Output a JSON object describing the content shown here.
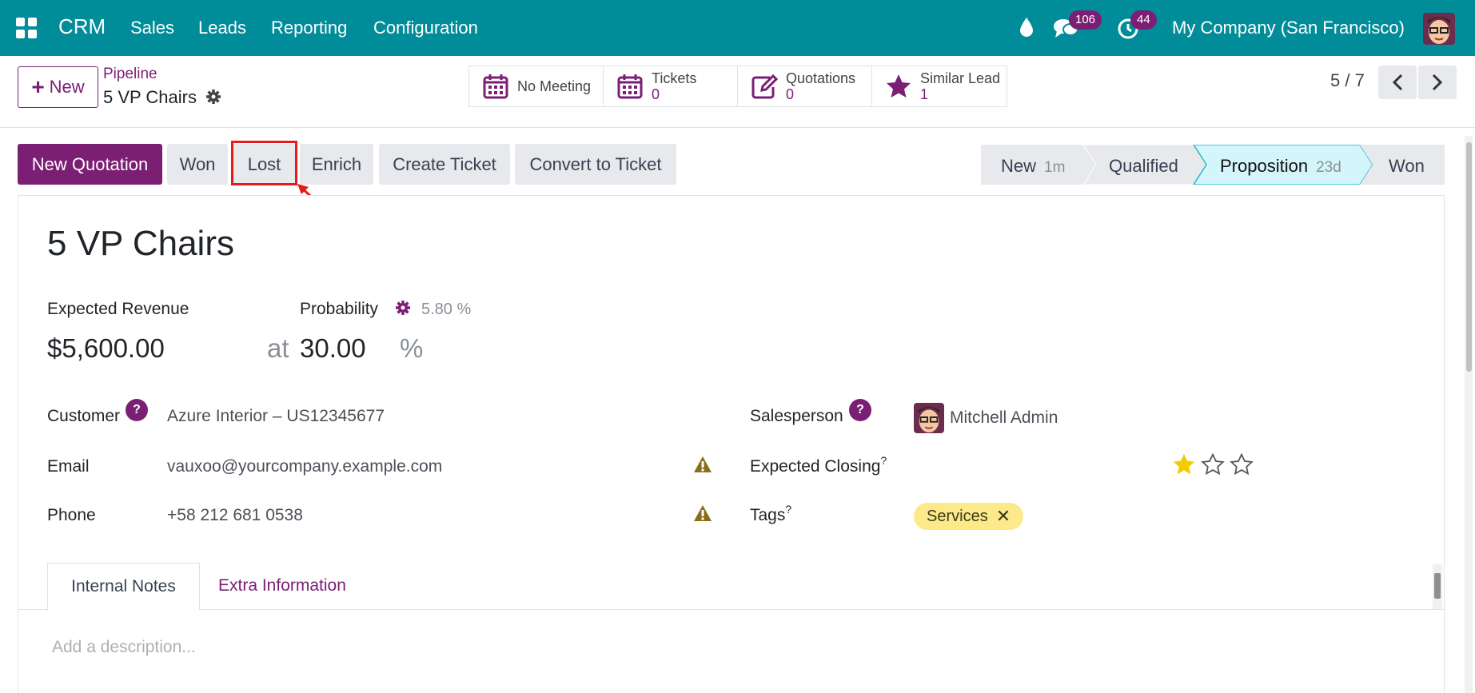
{
  "navbar": {
    "brand": "CRM",
    "menu": [
      "Sales",
      "Leads",
      "Reporting",
      "Configuration"
    ],
    "messages_count": "106",
    "activities_count": "44",
    "company": "My Company (San Francisco)"
  },
  "control_panel": {
    "new_label": "New",
    "breadcrumb_parent": "Pipeline",
    "breadcrumb_current": "5 VP Chairs",
    "smart_buttons": [
      {
        "label": "No Meeting",
        "value": ""
      },
      {
        "label": "Tickets",
        "value": "0"
      },
      {
        "label": "Quotations",
        "value": "0"
      },
      {
        "label": "Similar Lead",
        "value": "1"
      }
    ],
    "pager": "5 / 7"
  },
  "actions": {
    "new_quotation": "New Quotation",
    "won": "Won",
    "lost": "Lost",
    "enrich": "Enrich",
    "create_ticket": "Create Ticket",
    "convert_to_ticket": "Convert to Ticket"
  },
  "stages": [
    {
      "name": "New",
      "time": "1m",
      "active": false
    },
    {
      "name": "Qualified",
      "time": "",
      "active": false
    },
    {
      "name": "Proposition",
      "time": "23d",
      "active": true
    },
    {
      "name": "Won",
      "time": "",
      "active": false
    }
  ],
  "form": {
    "title": "5 VP Chairs",
    "expected_revenue_label": "Expected Revenue",
    "expected_revenue": "$5,600.00",
    "at": "at",
    "probability_label": "Probability",
    "probability_auto": "5.80 %",
    "probability": "30.00",
    "percent": "%",
    "customer_label": "Customer",
    "customer": "Azure Interior – US12345677",
    "email_label": "Email",
    "email": "vauxoo@yourcompany.example.com",
    "phone_label": "Phone",
    "phone": "+58 212 681 0538",
    "salesperson_label": "Salesperson",
    "salesperson": "Mitchell Admin",
    "expected_closing_label": "Expected Closing",
    "tags_label": "Tags",
    "tag": "Services",
    "priority": 1,
    "help_mark": "?"
  },
  "tabs": {
    "internal_notes": "Internal Notes",
    "extra_information": "Extra Information",
    "description_placeholder": "Add a description..."
  },
  "colors": {
    "navbar": "#018c99",
    "primary": "#7b1f74",
    "stage_active": "#d4f6fb",
    "highlight": "#e51b1b",
    "star": "#f3cc00",
    "warning": "#8a6d1a"
  }
}
